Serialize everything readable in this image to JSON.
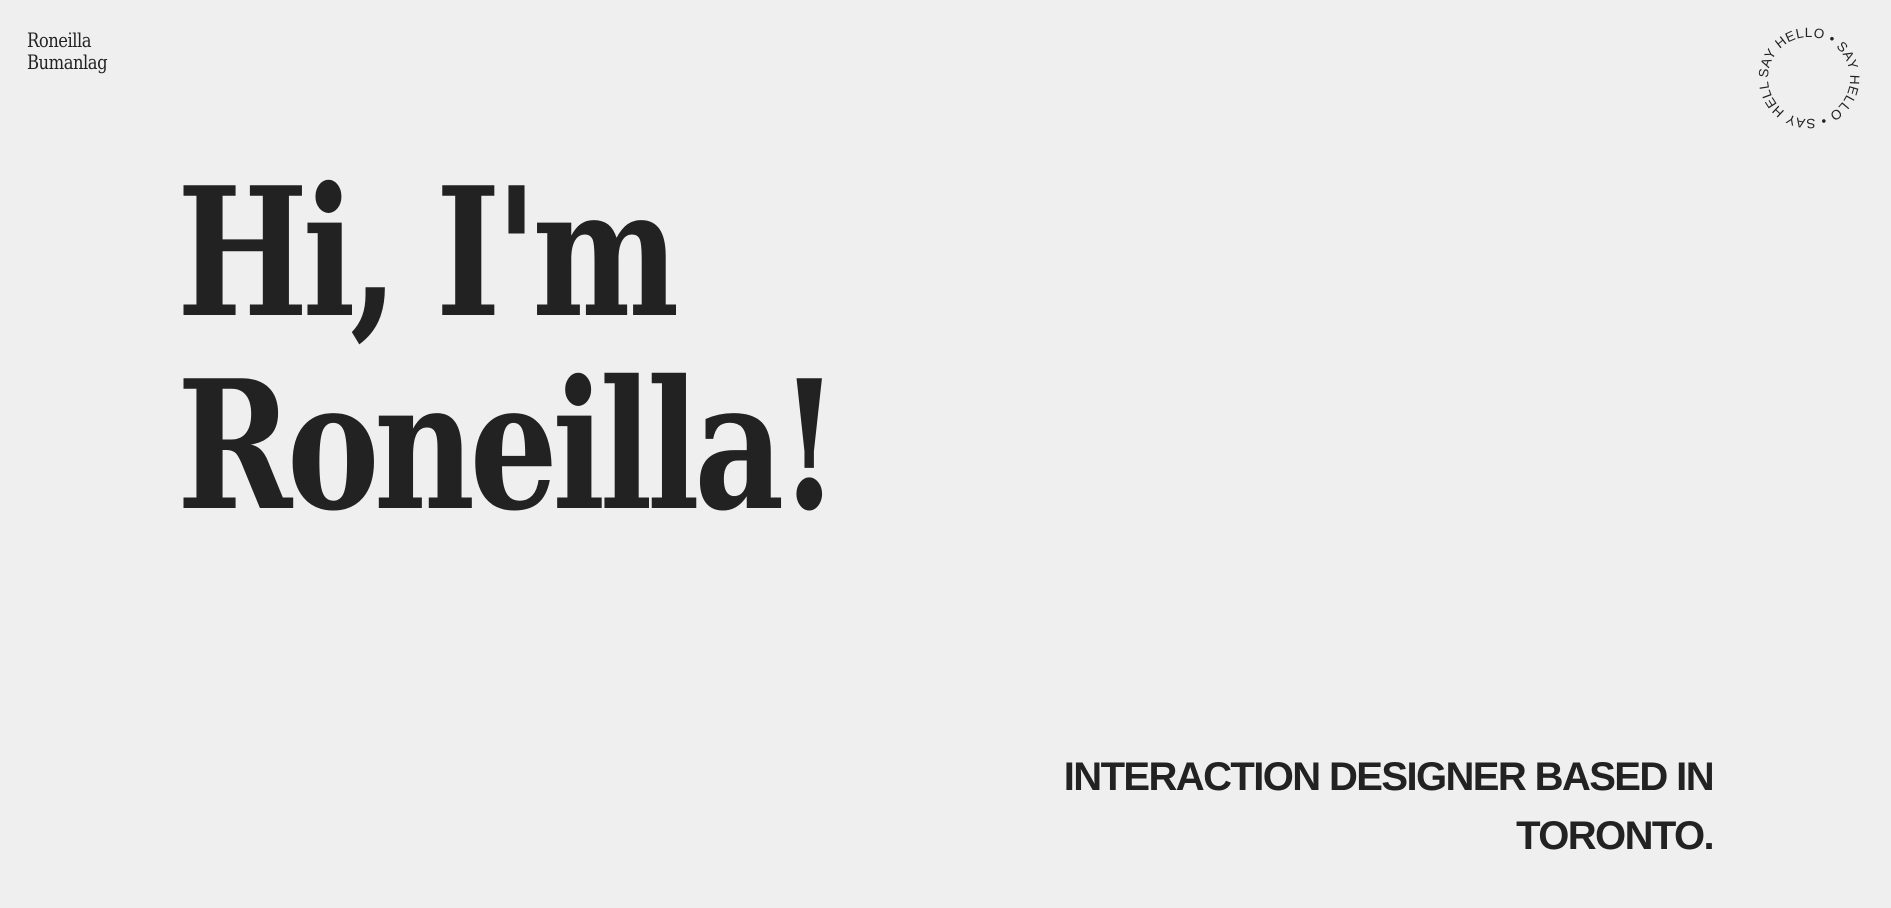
{
  "header": {
    "logo": {
      "line1": "Roneilla",
      "line2": "Bumanlag"
    },
    "say_hello": {
      "text": "SAY HELLO • SAY HELLO • SAY HELLO • "
    }
  },
  "hero": {
    "line1": "Hi, I'm",
    "line2": "Roneilla!"
  },
  "tagline": {
    "text": "INTERACTION DESIGNER BASED IN TORONTO."
  },
  "colors": {
    "background": "#efefef",
    "text": "#222222"
  }
}
